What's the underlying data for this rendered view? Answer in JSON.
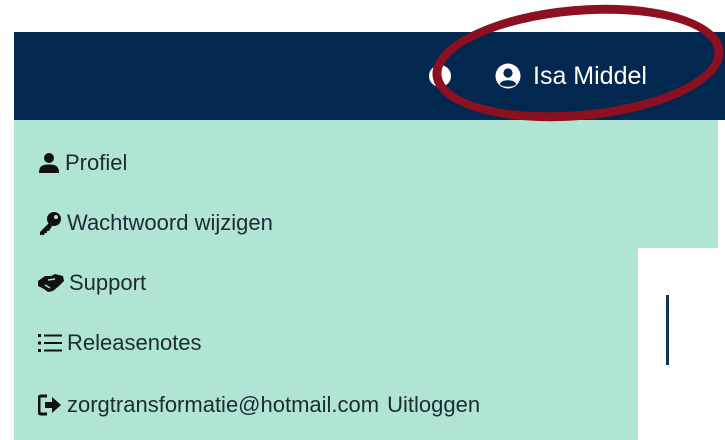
{
  "navbar": {
    "user_name": "Isa Middel",
    "colors": {
      "background": "#03284f",
      "text": "#ffffff"
    }
  },
  "user_menu": {
    "items": [
      {
        "label": "Profiel",
        "icon": "user-icon"
      },
      {
        "label": "Wachtwoord wijzigen",
        "icon": "key-icon"
      },
      {
        "label": "Support",
        "icon": "handshake-icon"
      },
      {
        "label": "Releasenotes",
        "icon": "list-icon"
      }
    ],
    "logout": {
      "email": "zorgtransformatie@hotmail.com",
      "label": "Uitloggen",
      "icon": "sign-out-icon"
    },
    "colors": {
      "background": "#b0e4d5",
      "text": "#1d2a36"
    }
  },
  "annotation": {
    "highlight_color": "#8c1020"
  }
}
